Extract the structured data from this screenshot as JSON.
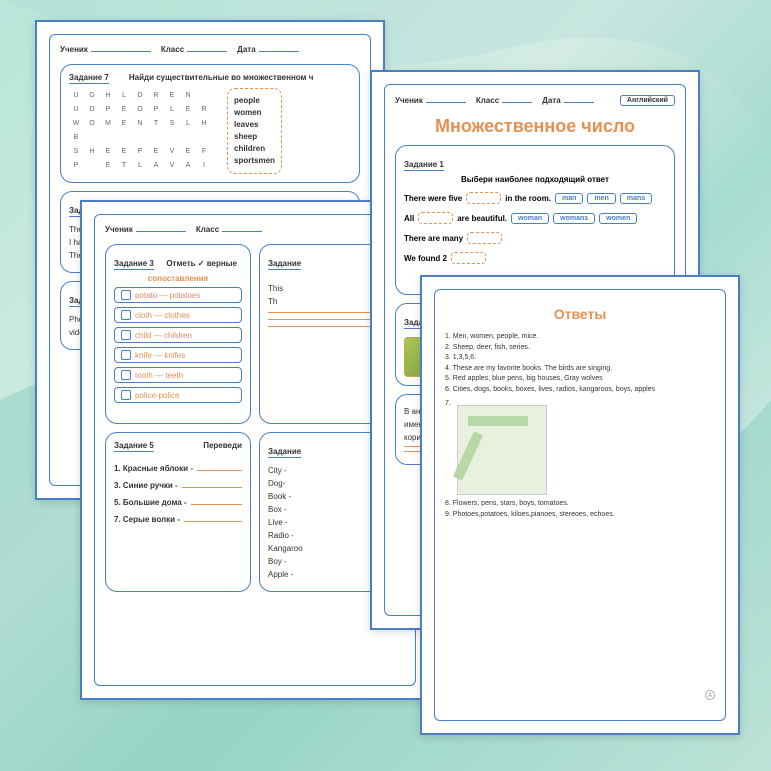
{
  "header": {
    "student": "Ученик",
    "class": "Класс",
    "date": "Дата",
    "language": "Английский"
  },
  "ws1": {
    "task7_label": "Задание 7",
    "task7_title": "Найди существительные во множественном ч",
    "letters": [
      "U",
      "G",
      "H",
      "L",
      "D",
      "R",
      "E",
      "N",
      "",
      "U",
      "D",
      "P",
      "E",
      "O",
      "P",
      "L",
      "E",
      "R",
      "W",
      "O",
      "M",
      "E",
      "N",
      "T",
      "S",
      "L",
      "H",
      "B",
      "",
      "",
      "",
      "",
      "",
      "",
      "",
      "",
      "S",
      "H",
      "E",
      "E",
      "P",
      "E",
      "V",
      "E",
      "F",
      "P",
      "",
      "E",
      "T",
      "L",
      "A",
      "V",
      "A",
      "I"
    ],
    "words": [
      "people",
      "women",
      "leaves",
      "sheep",
      "children",
      "sportsmen"
    ],
    "task_ex1": "There are",
    "task_ex2": "I have two",
    "task_ex3": "The",
    "task_zad": "Зад",
    "photos_text": "Photoes,",
    "videos_text": "videos, p"
  },
  "ws2": {
    "task3_label": "Задание 3",
    "task3_title": "Отметь ✓ верные",
    "task3_sub": "сопоставления",
    "matches": [
      "potato — potatoes",
      "cloth — clothes",
      "child — children",
      "knife — knifes",
      "tooth — teeth",
      "police-police"
    ],
    "task4_label": "Задание",
    "task4_text1": "This",
    "task4_text2": "Th",
    "task5_label": "Задание 5",
    "task5_title": "Переведи",
    "translate": [
      "1. Красные яблоки -",
      "3. Синие ручки -",
      "5. Большие дома -",
      "7. Серые волки -"
    ],
    "task6_label": "Задание",
    "task6_items": [
      "City -",
      "Dog-",
      "Book -",
      "Box -",
      "Live -",
      "Radio -",
      "Kangaroo",
      "Boy -",
      "Apple -"
    ]
  },
  "ws3": {
    "main_title": "Множественное число",
    "task1_label": "Задание 1",
    "task1_instruction": "Выбери наиболее подходящий ответ",
    "row1_text1": "There were five",
    "row1_text2": "in the room.",
    "row1_choices": [
      "man",
      "men",
      "mans"
    ],
    "row2_text1": "All",
    "row2_text2": "are beautiful.",
    "row2_choices": [
      "woman",
      "womans",
      "women"
    ],
    "row3_text": "There are many",
    "row4_text": "We found 2",
    "task2_label": "Задание 2",
    "info_text1": "В английском языке",
    "info_text2": "имеющиеся в алфави",
    "info_text3": "коричневая лисица п"
  },
  "ws4": {
    "title": "Ответы",
    "answers": [
      "1. Men, women, people, mice.",
      "2. Sheep, deer, fish, series.",
      "3. 1,3,5,6.",
      "4. These are my favorite books.  The birds are singing.",
      "5. Red apples, blue pens, big houses, Gray wolves",
      "6. Cities, dogs, books, boxes, lives, radios, kangaroos, boys, apples"
    ],
    "answer7": "7.",
    "answer8": "8. Flowers, pens, stars, boys, tomatoes.",
    "answer9": "9. Photoes,potatoes, kiloes,pianoes, stereoes, echoes.",
    "page_marker": "A"
  }
}
